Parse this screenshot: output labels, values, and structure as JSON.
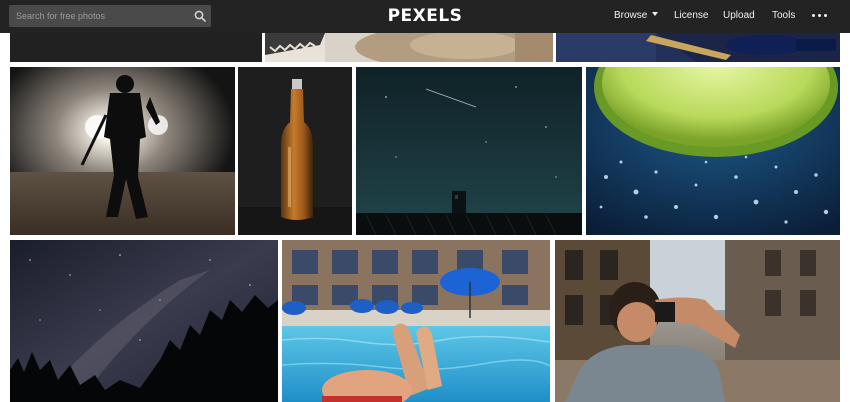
{
  "header": {
    "search_placeholder": "Search for free photos",
    "logo": "PEXELS",
    "nav": {
      "browse": "Browse",
      "license": "License",
      "upload": "Upload",
      "tools": "Tools"
    },
    "more_icon": "ellipsis-icon"
  },
  "gallery": {
    "row0_partial": [
      "dark-abstract",
      "saw-and-wood",
      "blue-cloth-with-pen"
    ],
    "row1": [
      "figure-in-fog-with-headlights",
      "beer-bottle",
      "night-sky-over-rooftop",
      "lime-slice-underwater"
    ],
    "row2": [
      "milky-way-over-trees",
      "feet-by-pool",
      "photographer-on-street"
    ]
  },
  "colors": {
    "header_bg": "#232323",
    "search_bg": "#4a4a4a",
    "page_bg": "#ffffff"
  }
}
